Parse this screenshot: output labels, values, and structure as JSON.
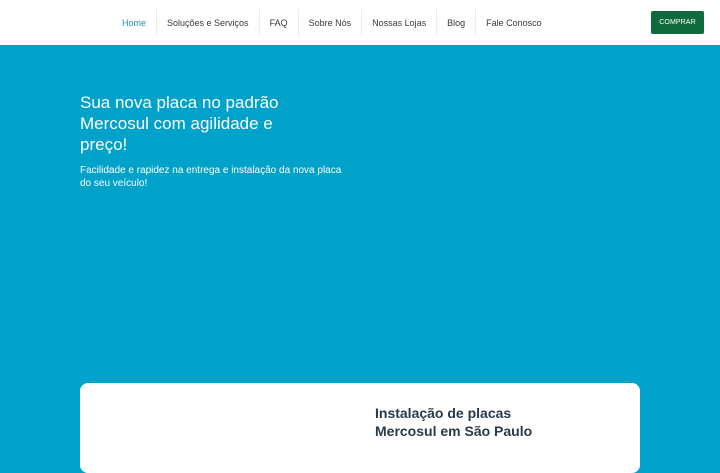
{
  "nav": {
    "items": [
      {
        "label": "Home",
        "active": true
      },
      {
        "label": "Soluções e Serviços",
        "active": false
      },
      {
        "label": "FAQ",
        "active": false
      },
      {
        "label": "Sobre Nós",
        "active": false
      },
      {
        "label": "Nossas Lojas",
        "active": false
      },
      {
        "label": "Blog",
        "active": false
      },
      {
        "label": "Fale Conosco",
        "active": false
      }
    ],
    "cta_label": "COMPRAR"
  },
  "hero": {
    "title": "Sua nova placa no padrão Mercosul com agilidade e preço!",
    "subtitle": "Facilidade e rapidez na entrega e instalação da nova placa do seu veículo!"
  },
  "card": {
    "title": "Instalação de placas Mercosul em São Paulo"
  },
  "colors": {
    "hero_background": "#00a2c9",
    "active_nav": "#1f8fc0",
    "cta_background": "#0f6b3d"
  }
}
